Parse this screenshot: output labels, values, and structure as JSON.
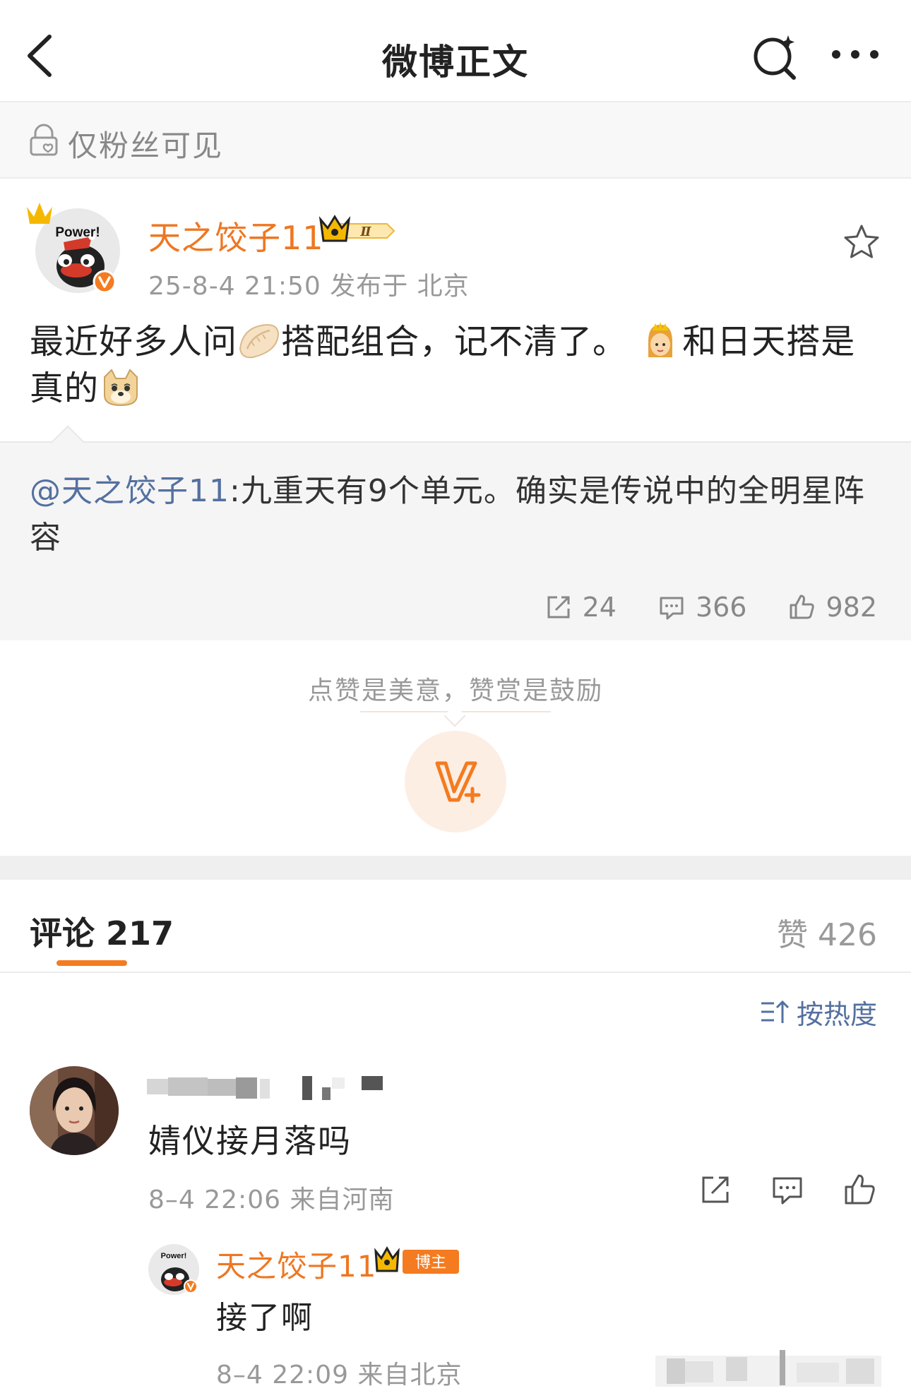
{
  "header": {
    "title": "微博正文"
  },
  "visibility": {
    "label": "仅粉丝可见"
  },
  "post": {
    "author": "天之饺子11",
    "avatar_text": "Power!",
    "level_badge": "Ⅱ",
    "meta": "25-8-4 21:50  发布于 北京",
    "text_part1": "最近好多人问",
    "text_part2": "搭配组合，记不清了。",
    "text_part3": "和日天搭是真的"
  },
  "repost": {
    "mention": "@天之饺子11",
    "text": ":九重天有9个单元。确实是传说中的全明星阵容",
    "stats": {
      "reposts": "24",
      "comments": "366",
      "likes": "982"
    }
  },
  "reward": {
    "prompt": "点赞是美意，赞赏是鼓励"
  },
  "tabs": {
    "comments_label": "评论 217",
    "likes_label": "赞 426"
  },
  "sort": {
    "label": "按热度"
  },
  "comment": {
    "text": "婧仪接月落吗",
    "meta": "8–4 22:06  来自河南"
  },
  "reply": {
    "author": "天之饺子11",
    "avatar_text": "Power!",
    "badge": "博主",
    "text": "接了啊",
    "meta": "8–4 22:09  来自北京"
  },
  "colors": {
    "accent": "#f47b20",
    "author": "#ee7722",
    "link": "#5470a0"
  }
}
